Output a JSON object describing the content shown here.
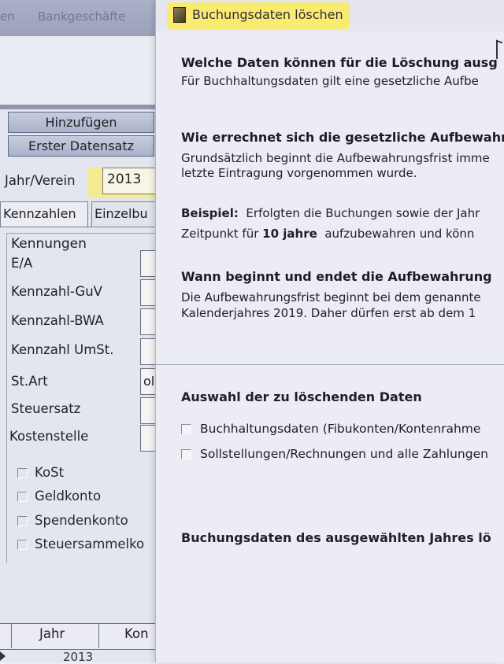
{
  "background_window": {
    "menu": [
      "en",
      "Bankgeschäfte"
    ],
    "buttons": {
      "add": "Hinzufügen",
      "first": "Erster Datensatz"
    },
    "year_label": "Jahr/Verein",
    "year_value": "2013",
    "tabs": [
      "Kennzahlen",
      "Einzelbu"
    ],
    "group_title": "Kennungen",
    "fields": [
      "E/A",
      "Kennzahl-GuV",
      "Kennzahl-BWA",
      "Kennzahl UmSt.",
      "St.Art",
      "Steuersatz",
      "Kostenstelle"
    ],
    "st_art_value": "ol",
    "checkboxes": [
      "KoSt",
      "Geldkonto",
      "Spendenkonto",
      "Steuersammelko"
    ],
    "table_headers": [
      "Jahr",
      "Kon"
    ],
    "table_first_row_year": "2013"
  },
  "dialog": {
    "title": "Buchungsdaten löschen",
    "q1_title": "Welche Daten können für die Löschung ausg",
    "q1_text": "Für Buchhaltungsdaten gilt eine gesetzliche Aufbe",
    "q2_title": "Wie errechnet sich die gesetzliche Aufbewahr",
    "q2_line1": "Grundsätzlich beginnt die Aufbewahrungsfrist imme",
    "q2_line2": "letzte Eintragung vorgenommen wurde.",
    "example_label": "Beispiel:",
    "example_line1": "Erfolgten die Buchungen sowie der Jahr",
    "example_line2_pre": "Zeitpunkt für",
    "example_line2_bold": "10 jahre",
    "example_line2_post": "aufzubewahren und könn",
    "q3_title": "Wann beginnt und endet die Aufbewahrung",
    "q3_line1": "Die Aufbewahrungsfrist beginnt bei dem genannte",
    "q3_line2": "Kalenderjahres 2019. Daher dürfen erst ab dem 1",
    "selection_title": "Auswahl der zu löschenden Daten",
    "options": [
      "Buchhaltungsdaten (Fibukonten/Kontenrahme",
      "Sollstellungen/Rechnungen und alle Zahlungen"
    ],
    "footer_question": "Buchungsdaten des ausgewählten Jahres lö"
  }
}
